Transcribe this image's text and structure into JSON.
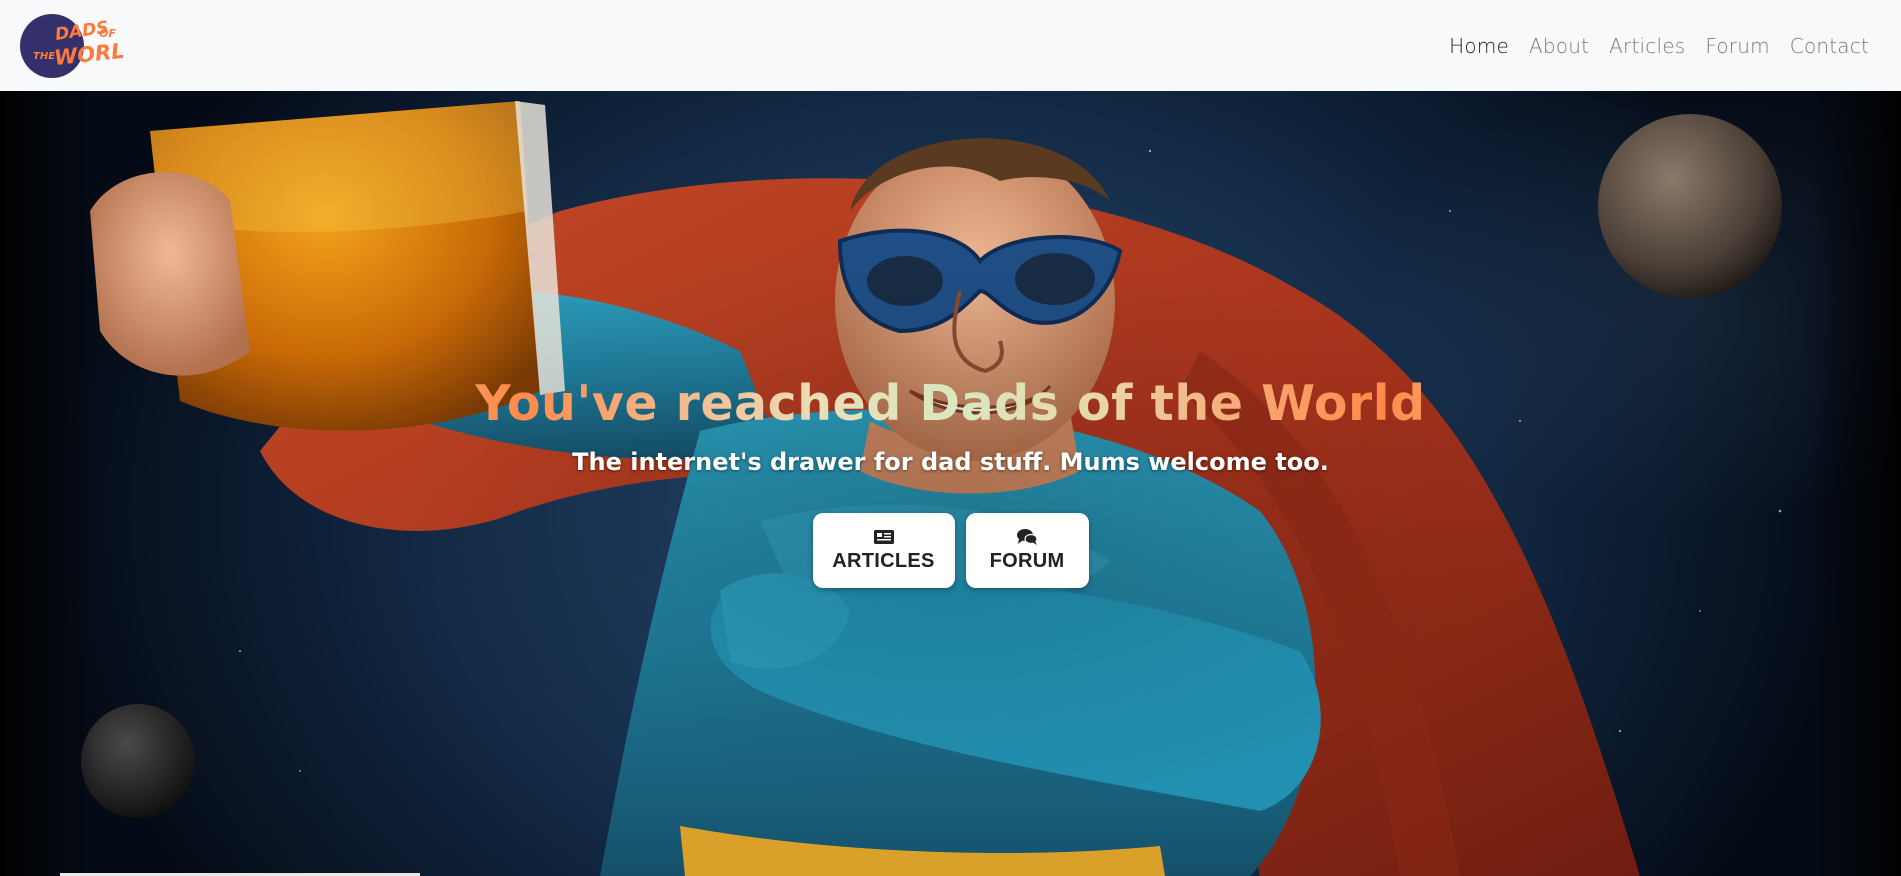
{
  "brand": {
    "logo_text_line1": "DADS",
    "logo_text_of": "OF",
    "logo_text_the": "THE",
    "logo_text_line2": "WORLD",
    "logo_bg_color": "#3a3a7a",
    "logo_text_color": "#ff7a3d"
  },
  "nav": {
    "items": [
      {
        "label": "Home",
        "active": true
      },
      {
        "label": "About",
        "active": false
      },
      {
        "label": "Articles",
        "active": false
      },
      {
        "label": "Forum",
        "active": false
      },
      {
        "label": "Contact",
        "active": false
      }
    ]
  },
  "hero": {
    "title": "You've reached Dads of the World",
    "subtitle": "The internet's drawer for dad stuff. Mums welcome too.",
    "buttons": [
      {
        "label": "ARTICLES",
        "icon": "newspaper-icon"
      },
      {
        "label": "FORUM",
        "icon": "comments-icon"
      }
    ],
    "background_image": "superhero-dad-with-beer-in-space"
  },
  "colors": {
    "navbar_bg": "#f8f9fa",
    "nav_active": "#1d1d1d",
    "nav_inactive": "#7a7a7a",
    "title_gradient_start": "#ff8a4a",
    "title_gradient_mid": "#d8e8c0",
    "button_bg": "#ffffff"
  }
}
